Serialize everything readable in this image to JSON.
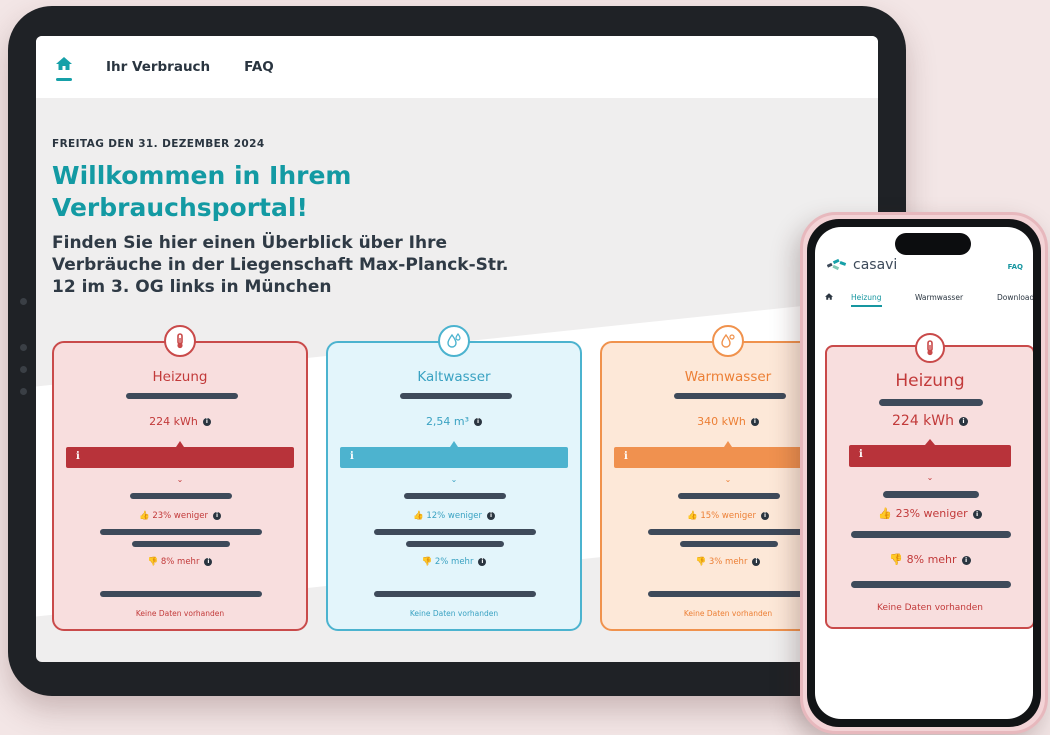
{
  "tablet": {
    "nav": {
      "home_icon": "home-icon",
      "items": [
        "Ihr Verbrauch",
        "FAQ"
      ]
    },
    "date": "FREITAG DEN 31. DEZEMBER 2024",
    "title": "Willkommen in Ihrem Verbrauchsportal!",
    "subtitle": "Finden Sie hier einen Überblick über Ihre Verbräuche in der Liegenschaft Max-Planck-Str. 12 im 3. OG links in München",
    "cards": [
      {
        "name": "Heizung",
        "icon": "thermometer-icon",
        "value": "224 kWh",
        "less": "23% weniger",
        "more": "8% mehr",
        "footer": "Keine Daten vorhanden",
        "color": "#c94a4a"
      },
      {
        "name": "Kaltwasser",
        "icon": "water-drops-icon",
        "value": "2,54 m³",
        "less": "12% weniger",
        "more": "2% mehr",
        "footer": "Keine Daten vorhanden",
        "color": "#4bb3cf"
      },
      {
        "name": "Warmwasser",
        "icon": "hot-water-drops-icon",
        "value": "340 kWh",
        "less": "15% weniger",
        "more": "3% mehr",
        "footer": "Keine Daten vorhanden",
        "color": "#f0924d"
      }
    ]
  },
  "phone": {
    "brand": "casavi",
    "faq": "FAQ",
    "tabs": [
      "Heizung",
      "Warmwasser",
      "Download"
    ],
    "active_tab": "Heizung",
    "card": {
      "name": "Heizung",
      "value": "224 kWh",
      "less": "23% weniger",
      "more": "8% mehr",
      "footer": "Keine Daten vorhanden"
    }
  },
  "colors": {
    "teal": "#16a0a8",
    "heating": "#c94a4a",
    "cold_water": "#4bb3cf",
    "warm_water": "#f0924d",
    "dark_bar": "#3e4a5a"
  }
}
